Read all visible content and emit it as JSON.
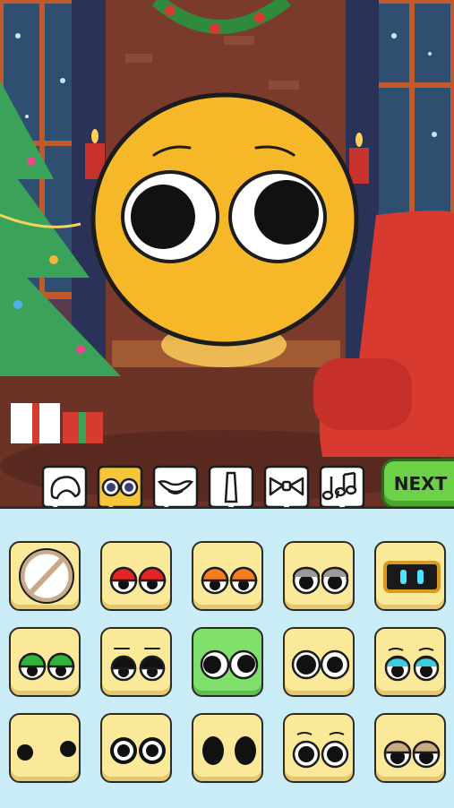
{
  "scene": {
    "theme": "christmas-living-room",
    "colors": {
      "wall": "#6b3b2e",
      "window": "#2d4b6a",
      "tree": "#3ba25a",
      "armchair": "#d8382f",
      "fireplace": "#8a4a2c",
      "floor": "#5e2f22"
    }
  },
  "character": {
    "skin_color": "#f6b828",
    "eye_style": "big-round-white"
  },
  "tabs": [
    {
      "name": "hair",
      "icon": "hair-icon",
      "selected": false
    },
    {
      "name": "eyes",
      "icon": "eyes-icon",
      "selected": true
    },
    {
      "name": "mouth",
      "icon": "mouth-icon",
      "selected": false
    },
    {
      "name": "tie",
      "icon": "tie-icon",
      "selected": false
    },
    {
      "name": "bow",
      "icon": "bow-icon",
      "selected": false
    },
    {
      "name": "music",
      "icon": "music-notes-icon",
      "selected": false
    }
  ],
  "next_button": {
    "label": "NEXT"
  },
  "eye_options": [
    {
      "style": "none",
      "selected": false
    },
    {
      "style": "red-lids",
      "selected": false
    },
    {
      "style": "orange-lids",
      "selected": false
    },
    {
      "style": "grey-lids",
      "selected": false
    },
    {
      "style": "robot-visor",
      "selected": false
    },
    {
      "style": "green-lids",
      "selected": false
    },
    {
      "style": "sleepy-black",
      "selected": false
    },
    {
      "style": "big-round",
      "selected": true
    },
    {
      "style": "pupils-round",
      "selected": false
    },
    {
      "style": "cyan-lids",
      "selected": false
    },
    {
      "style": "dots",
      "selected": false
    },
    {
      "style": "outlined-round",
      "selected": false
    },
    {
      "style": "ovals",
      "selected": false
    },
    {
      "style": "brows-round",
      "selected": false
    },
    {
      "style": "tan-lids",
      "selected": false
    }
  ],
  "colors": {
    "accent": "#6cd146",
    "panel": "#c9ecf6",
    "cell": "#fbe99a",
    "cell_selected": "#7fe06b",
    "outline": "#2a2a2a"
  }
}
